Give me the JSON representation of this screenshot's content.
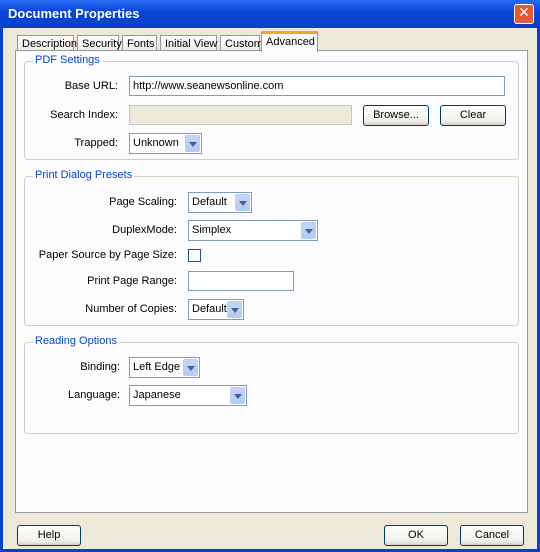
{
  "window": {
    "title": "Document Properties",
    "close_glyph": "✕"
  },
  "tabs": [
    "Description",
    "Security",
    "Fonts",
    "Initial View",
    "Custom",
    "Advanced"
  ],
  "pdf_settings": {
    "legend": "PDF Settings",
    "base_url_label": "Base URL:",
    "base_url_value": "http://www.seanewsonline.com",
    "search_index_label": "Search Index:",
    "search_index_value": "",
    "browse_label": "Browse...",
    "clear_label": "Clear",
    "trapped_label": "Trapped:",
    "trapped_value": "Unknown"
  },
  "print_presets": {
    "legend": "Print Dialog Presets",
    "page_scaling_label": "Page Scaling:",
    "page_scaling_value": "Default",
    "duplex_label": "DuplexMode:",
    "duplex_value": "Simplex",
    "paper_source_label": "Paper Source by Page Size:",
    "paper_source_checked": false,
    "print_range_label": "Print Page Range:",
    "print_range_value": "",
    "copies_label": "Number of Copies:",
    "copies_value": "Default"
  },
  "reading_options": {
    "legend": "Reading Options",
    "binding_label": "Binding:",
    "binding_value": "Left Edge",
    "language_label": "Language:",
    "language_value": "Japanese"
  },
  "footer": {
    "help_label": "Help",
    "ok_label": "OK",
    "cancel_label": "Cancel"
  },
  "colors": {
    "titlebar": "#0a46d8",
    "dialog_bg": "#ece9d8",
    "legend": "#0046d5",
    "active_tab_accent": "#f5a623"
  }
}
